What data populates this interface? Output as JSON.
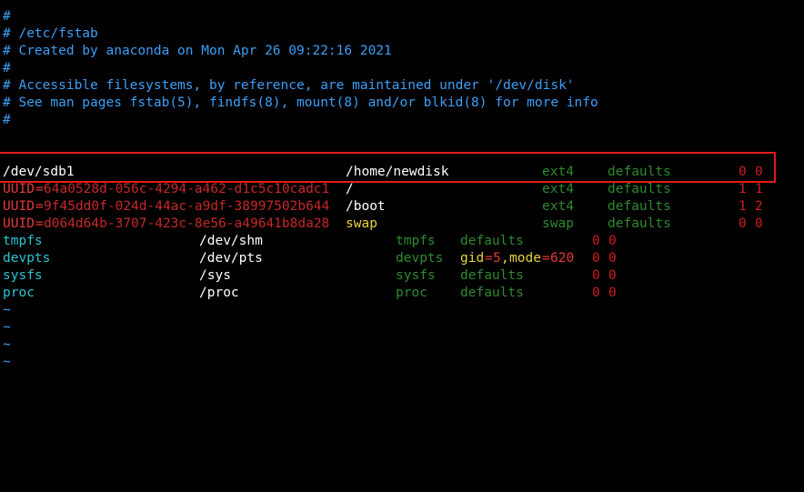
{
  "header": {
    "lines": [
      "#",
      "# /etc/fstab",
      "# Created by anaconda on Mon Apr 26 09:22:16 2021",
      "#",
      "# Accessible filesystems, by reference, are maintained under '/dev/disk'",
      "# See man pages fstab(5), findfs(8), mount(8) and/or blkid(8) for more info",
      "#"
    ]
  },
  "entries": [
    {
      "device": "/dev/sdb1",
      "mount": "/home/newdisk",
      "fstype": "ext4",
      "options": "defaults",
      "dump": "0",
      "pass": "0"
    },
    {
      "uuid_key": "UUID",
      "eq": "=",
      "uuid": "64a0528d-056c-4294-a462-d1c5c10cadc1",
      "mount": "/",
      "fstype": "ext4",
      "options": "defaults",
      "dump": "1",
      "pass": "1"
    },
    {
      "uuid_key": "UUID",
      "eq": "=",
      "uuid": "9f45dd0f-024d-44ac-a9df-38997502b644",
      "mount": "/boot",
      "fstype": "ext4",
      "options": "defaults",
      "dump": "1",
      "pass": "2"
    },
    {
      "uuid_key": "UUID",
      "eq": "=",
      "uuid": "d064d64b-3707-423c-8e56-a49641b8da28",
      "mount": "swap",
      "fstype": "swap",
      "options": "defaults",
      "dump": "0",
      "pass": "0"
    },
    {
      "device": "tmpfs",
      "mount": "/dev/shm",
      "fstype": "tmpfs",
      "options": "defaults",
      "dump": "0",
      "pass": "0"
    },
    {
      "device": "devpts",
      "mount": "/dev/pts",
      "fstype": "devpts",
      "opt_gid_key": "gid",
      "opt_gid_eq": "=",
      "opt_gid_val": "5",
      "opt_comma": ",",
      "opt_mode_key": "mode",
      "opt_mode_eq": "=",
      "opt_mode_val": "620",
      "dump": "0",
      "pass": "0"
    },
    {
      "device": "sysfs",
      "mount": "/sys",
      "fstype": "sysfs",
      "options": "defaults",
      "dump": "0",
      "pass": "0"
    },
    {
      "device": "proc",
      "mount": "/proc",
      "fstype": "proc",
      "options": "defaults",
      "dump": "0",
      "pass": "0"
    }
  ],
  "tildes": [
    "~",
    "~",
    "~",
    "~"
  ],
  "colors": {
    "comment": "#3d9ff5",
    "device": "#2bc3d2",
    "uuid": "#c62828",
    "fstype": "#2e8b2e",
    "options": "#2e8b2e",
    "dump_pass": "#d01c1c",
    "swap": "#e6d33a",
    "highlight": "#e31b1b"
  }
}
